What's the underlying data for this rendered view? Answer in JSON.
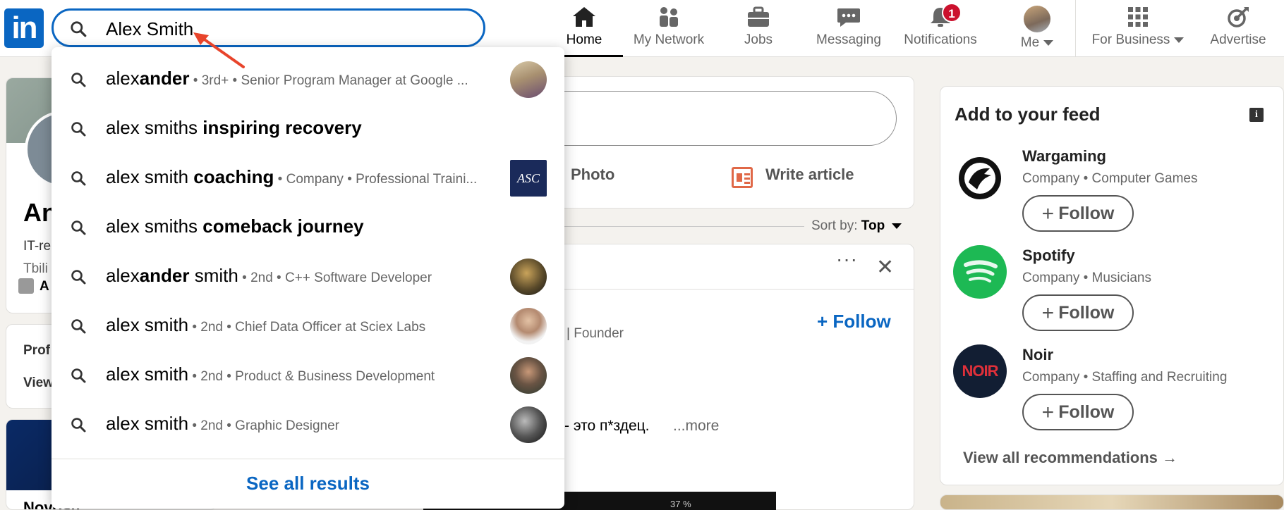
{
  "nav": {
    "logo_text": "in",
    "search": {
      "value": "Alex Smith"
    },
    "items": [
      {
        "label": "Home",
        "icon": "home-icon",
        "active": true
      },
      {
        "label": "My Network",
        "icon": "people-icon"
      },
      {
        "label": "Jobs",
        "icon": "briefcase-icon"
      },
      {
        "label": "Messaging",
        "icon": "chat-bubble-icon"
      },
      {
        "label": "Notifications",
        "icon": "bell-icon",
        "badge": "1"
      },
      {
        "label": "Me",
        "icon": "avatar"
      },
      {
        "label": "For Business",
        "icon": "grid-icon"
      },
      {
        "label": "Advertise",
        "icon": "target-arrow-icon"
      }
    ]
  },
  "dropdown": {
    "suggestions": [
      {
        "plain": "alex",
        "bold": "ander",
        "rest": "",
        "meta": " • 3rd+ • Senior Program Manager at Google ..."
      },
      {
        "plain": "alex smiths",
        "bold": " inspiring recovery",
        "rest": "",
        "meta": ""
      },
      {
        "plain": "alex smith",
        "bold": " coaching",
        "rest": "",
        "meta": " • Company • Professional Traini..."
      },
      {
        "plain": "alex smiths",
        "bold": " comeback journey",
        "rest": "",
        "meta": ""
      },
      {
        "plain": "alex",
        "bold": "ander",
        "rest": " smith",
        "meta": " • 2nd • C++ Software Developer"
      },
      {
        "plain": "alex smith",
        "bold": "",
        "rest": "",
        "meta": " • 2nd • Chief Data Officer at Sciex Labs"
      },
      {
        "plain": "alex smith",
        "bold": "",
        "rest": "",
        "meta": " • 2nd • Product & Business Development"
      },
      {
        "plain": "alex smith",
        "bold": "",
        "rest": "",
        "meta": " • 2nd • Graphic Designer"
      }
    ],
    "company_logo_text": "ASC",
    "see_all": "See all results"
  },
  "profile": {
    "name_partial": "An",
    "line1": "IT-re",
    "line2": "Tbili",
    "link_partial": "A",
    "section_profile": "Prof",
    "section_view": "View",
    "bottom_title": "Novosti"
  },
  "post_start": {
    "photo": "Photo",
    "write_article": "Write article"
  },
  "feed": {
    "sort_label": "Sort by:",
    "sort_value": "Top",
    "dots": "···",
    "close": "✕",
    "follow": "+ Follow",
    "founder": "| Founder",
    "text": "- это п*здец.",
    "more": "...more",
    "phone_status": "37 %"
  },
  "rail": {
    "title": "Add to your feed",
    "info": "i",
    "recommendations": [
      {
        "name": "Wargaming",
        "desc": "Company • Computer Games",
        "follow": "Follow"
      },
      {
        "name": "Spotify",
        "desc": "Company • Musicians",
        "follow": "Follow"
      },
      {
        "name": "Noir",
        "desc": "Company • Staffing and Recruiting",
        "follow": "Follow",
        "logo_text": "NOIR"
      }
    ],
    "view_all": "View all recommendations →"
  },
  "colors": {
    "brand": "#0a66c2",
    "badge": "#cb112d",
    "annotation_arrow": "#e8442b"
  }
}
